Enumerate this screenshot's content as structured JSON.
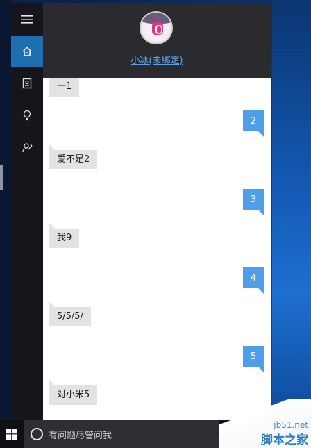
{
  "header": {
    "user_name": "小冰(未绑定)"
  },
  "rail": {
    "items": [
      {
        "icon": "hamburger-menu-icon"
      },
      {
        "icon": "home-icon",
        "active": true
      },
      {
        "icon": "notebook-icon"
      },
      {
        "icon": "lightbulb-icon"
      },
      {
        "icon": "feedback-icon"
      }
    ]
  },
  "chat": {
    "messages": [
      {
        "side": "left",
        "text": "一1"
      },
      {
        "side": "right",
        "text": "2"
      },
      {
        "side": "left",
        "text": "爱不是2"
      },
      {
        "side": "right",
        "text": "3"
      },
      {
        "side": "left",
        "text": "我9"
      },
      {
        "side": "right",
        "text": "4"
      },
      {
        "side": "left",
        "text": "5/5/5/"
      },
      {
        "side": "right",
        "text": "5"
      },
      {
        "side": "left",
        "text": "对小米5"
      }
    ]
  },
  "taskbar": {
    "search_placeholder": "有问题尽管问我"
  },
  "watermark": {
    "domain": "jb51.net",
    "brand": "脚本之家"
  },
  "colors": {
    "accent": "#1f6fb0",
    "user_bubble": "#4f9fe8",
    "bot_bubble": "#e3e3e3",
    "link": "#5aa3e6"
  }
}
